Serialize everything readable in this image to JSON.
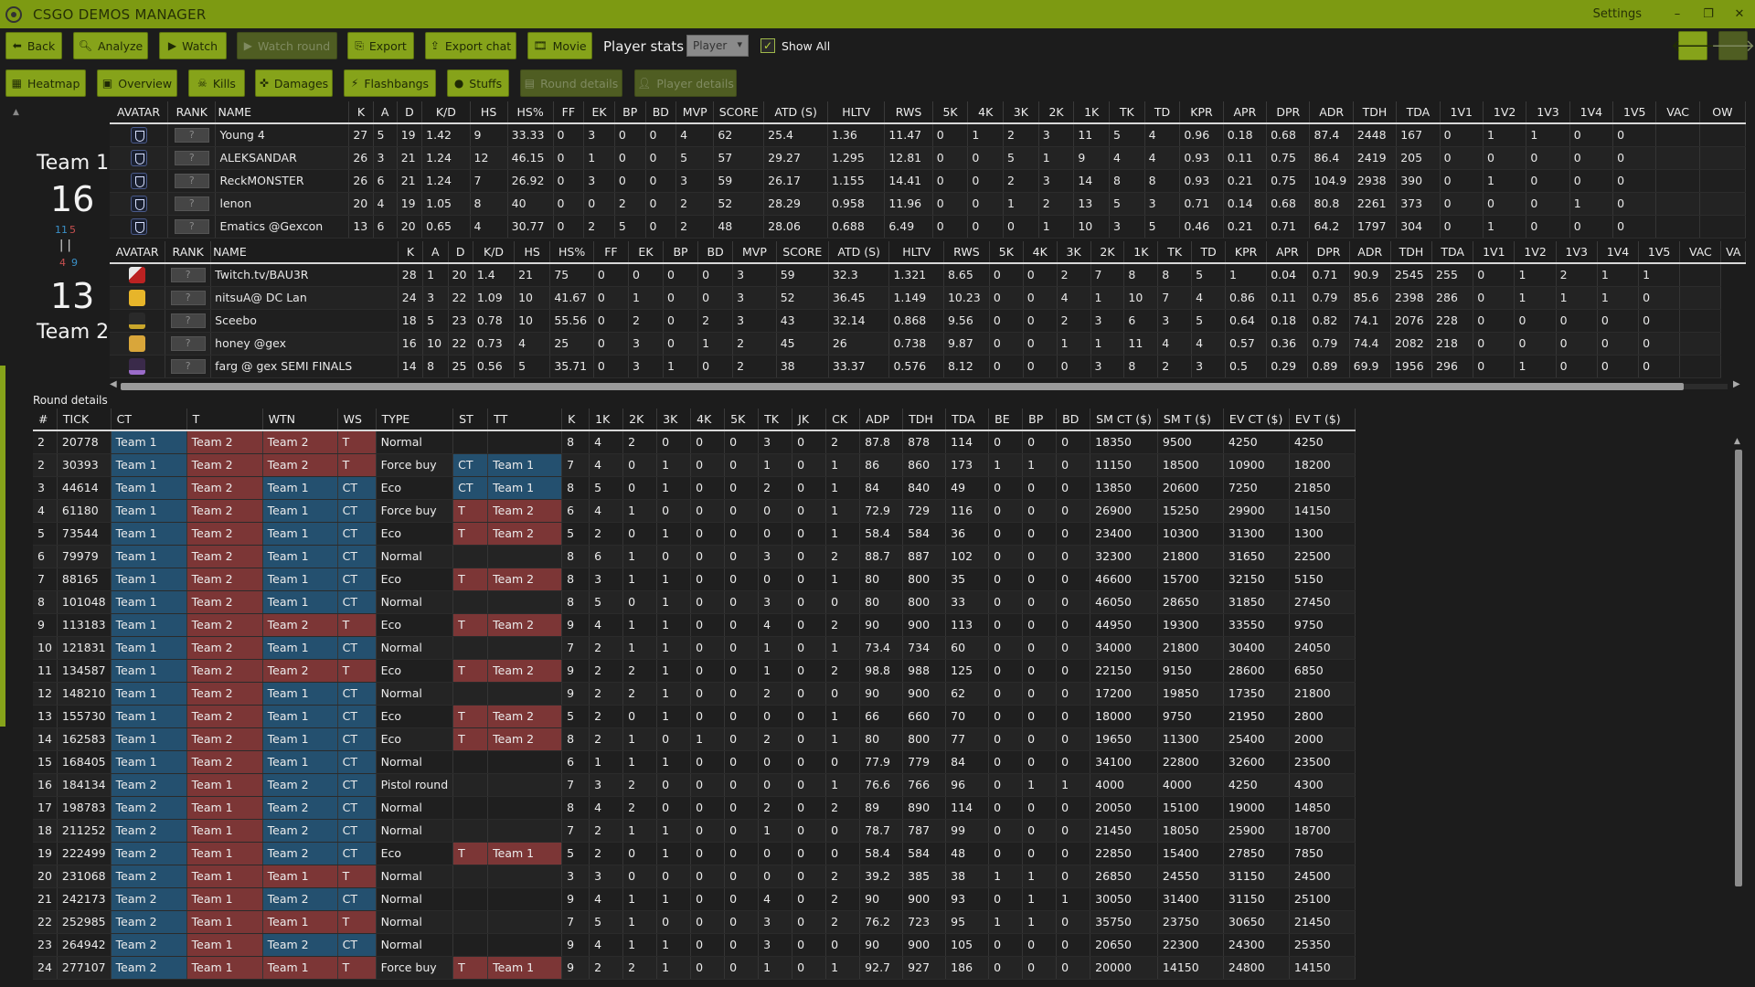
{
  "window": {
    "title": "CSGO DEMOS MANAGER",
    "settings": "Settings",
    "minimize": "–",
    "restore": "❐",
    "close": "✕"
  },
  "toolbar": {
    "back": "Back",
    "analyze": "Analyze",
    "watch": "Watch",
    "watch_round": "Watch round",
    "export": "Export",
    "export_chat": "Export chat",
    "movie": "Movie",
    "player_stats": "Player stats",
    "player_select": "Player",
    "show_all": "Show All"
  },
  "tabs": {
    "heatmap": "Heatmap",
    "overview": "Overview",
    "kills": "Kills",
    "damages": "Damages",
    "flashbangs": "Flashbangs",
    "stuffs": "Stuffs",
    "round_details": "Round details",
    "player_details": "Player details"
  },
  "teams": {
    "team1": {
      "name": "Team 1",
      "score": "16",
      "ct": "11",
      "t": "5"
    },
    "team2": {
      "name": "Team 2",
      "score": "13",
      "ct": "4",
      "t": "9"
    },
    "sep": "|  |"
  },
  "player_columns": [
    "AVATAR",
    "RANK",
    "NAME",
    "K",
    "A",
    "D",
    "K/D",
    "HS",
    "HS%",
    "FF",
    "EK",
    "BP",
    "BD",
    "MVP",
    "SCORE",
    "ATD (S)",
    "HLTV",
    "RWS",
    "5K",
    "4K",
    "3K",
    "2K",
    "1K",
    "TK",
    "TD",
    "KPR",
    "APR",
    "DPR",
    "ADR",
    "TDH",
    "TDA",
    "1V1",
    "1V2",
    "1V3",
    "1V4",
    "1V5",
    "VAC",
    "OW"
  ],
  "rank_placeholder": "?",
  "team1_players": [
    {
      "avatar": "shield",
      "cells": [
        "Young 4",
        "27",
        "5",
        "19",
        "1.42",
        "9",
        "33.33",
        "0",
        "3",
        "0",
        "0",
        "4",
        "62",
        "25.4",
        "1.36",
        "11.47",
        "0",
        "1",
        "2",
        "3",
        "11",
        "5",
        "4",
        "0.96",
        "0.18",
        "0.68",
        "87.4",
        "2448",
        "167",
        "0",
        "1",
        "1",
        "0",
        "0",
        "",
        ""
      ]
    },
    {
      "avatar": "shield",
      "cells": [
        "ALEKSANDAR",
        "26",
        "3",
        "21",
        "1.24",
        "12",
        "46.15",
        "0",
        "1",
        "0",
        "0",
        "5",
        "57",
        "29.27",
        "1.295",
        "12.81",
        "0",
        "0",
        "5",
        "1",
        "9",
        "4",
        "4",
        "0.93",
        "0.11",
        "0.75",
        "86.4",
        "2419",
        "205",
        "0",
        "0",
        "0",
        "0",
        "0",
        "",
        ""
      ]
    },
    {
      "avatar": "shield",
      "cells": [
        "ReckMONSTER",
        "26",
        "6",
        "21",
        "1.24",
        "7",
        "26.92",
        "0",
        "3",
        "0",
        "0",
        "3",
        "59",
        "26.17",
        "1.155",
        "14.41",
        "0",
        "0",
        "2",
        "3",
        "14",
        "8",
        "8",
        "0.93",
        "0.21",
        "0.75",
        "104.9",
        "2938",
        "390",
        "0",
        "1",
        "0",
        "0",
        "0",
        "",
        ""
      ]
    },
    {
      "avatar": "shield",
      "cells": [
        "lenon",
        "20",
        "4",
        "19",
        "1.05",
        "8",
        "40",
        "0",
        "0",
        "2",
        "0",
        "2",
        "52",
        "28.29",
        "0.958",
        "11.96",
        "0",
        "0",
        "1",
        "2",
        "13",
        "5",
        "3",
        "0.71",
        "0.14",
        "0.68",
        "80.8",
        "2261",
        "373",
        "0",
        "0",
        "0",
        "1",
        "0",
        "",
        ""
      ]
    },
    {
      "avatar": "shield",
      "cells": [
        "Ematics @Gexcon",
        "13",
        "6",
        "20",
        "0.65",
        "4",
        "30.77",
        "0",
        "2",
        "5",
        "0",
        "2",
        "48",
        "28.06",
        "0.688",
        "6.49",
        "0",
        "0",
        "0",
        "1",
        "10",
        "3",
        "5",
        "0.46",
        "0.21",
        "0.71",
        "64.2",
        "1797",
        "304",
        "0",
        "1",
        "0",
        "0",
        "0",
        "",
        ""
      ]
    }
  ],
  "team2_players": [
    {
      "avatar": "a",
      "cells": [
        "Twitch.tv/BAU3R",
        "28",
        "1",
        "20",
        "1.4",
        "21",
        "75",
        "0",
        "0",
        "0",
        "0",
        "3",
        "59",
        "32.3",
        "1.321",
        "8.65",
        "0",
        "0",
        "2",
        "7",
        "8",
        "8",
        "5",
        "1",
        "0.04",
        "0.71",
        "90.9",
        "2545",
        "255",
        "0",
        "1",
        "2",
        "1",
        "1",
        ""
      ]
    },
    {
      "avatar": "b",
      "cells": [
        "nitsuA@ DC Lan",
        "24",
        "3",
        "22",
        "1.09",
        "10",
        "41.67",
        "0",
        "1",
        "0",
        "0",
        "3",
        "52",
        "36.45",
        "1.149",
        "10.23",
        "0",
        "0",
        "4",
        "1",
        "10",
        "7",
        "4",
        "0.86",
        "0.11",
        "0.79",
        "85.6",
        "2398",
        "286",
        "0",
        "1",
        "1",
        "1",
        "0",
        ""
      ]
    },
    {
      "avatar": "c",
      "cells": [
        "Sceebo",
        "18",
        "5",
        "23",
        "0.78",
        "10",
        "55.56",
        "0",
        "2",
        "0",
        "2",
        "3",
        "43",
        "32.14",
        "0.868",
        "9.56",
        "0",
        "0",
        "2",
        "3",
        "6",
        "3",
        "5",
        "0.64",
        "0.18",
        "0.82",
        "74.1",
        "2076",
        "228",
        "0",
        "0",
        "0",
        "0",
        "0",
        ""
      ]
    },
    {
      "avatar": "d",
      "cells": [
        "honey @gex",
        "16",
        "10",
        "22",
        "0.73",
        "4",
        "25",
        "0",
        "3",
        "0",
        "1",
        "2",
        "45",
        "26",
        "0.738",
        "9.87",
        "0",
        "0",
        "1",
        "1",
        "11",
        "4",
        "4",
        "0.57",
        "0.36",
        "0.79",
        "74.4",
        "2082",
        "218",
        "0",
        "0",
        "0",
        "0",
        "0",
        ""
      ]
    },
    {
      "avatar": "e",
      "cells": [
        "farg @ gex SEMI FINALS",
        "14",
        "8",
        "25",
        "0.56",
        "5",
        "35.71",
        "0",
        "3",
        "1",
        "0",
        "2",
        "38",
        "33.37",
        "0.576",
        "8.12",
        "0",
        "0",
        "0",
        "3",
        "8",
        "2",
        "3",
        "0.5",
        "0.29",
        "0.89",
        "69.9",
        "1956",
        "296",
        "0",
        "1",
        "0",
        "0",
        "0",
        ""
      ]
    }
  ],
  "team2_columns_extra": "VA",
  "round_details": {
    "label": "Round details",
    "columns": [
      "#",
      "TICK",
      "CT",
      "T",
      "WTN",
      "WS",
      "TYPE",
      "ST",
      "TT",
      "K",
      "1K",
      "2K",
      "3K",
      "4K",
      "5K",
      "TK",
      "JK",
      "CK",
      "ADP",
      "TDH",
      "TDA",
      "BE",
      "BP",
      "BD",
      "SM CT ($)",
      "SM T ($)",
      "EV CT ($)",
      "EV T ($)"
    ],
    "rows": [
      [
        "2",
        "20778",
        "Team 1",
        "Team 2",
        "Team 2",
        "T",
        "Normal",
        "",
        "",
        "8",
        "4",
        "2",
        "0",
        "0",
        "0",
        "3",
        "0",
        "2",
        "87.8",
        "878",
        "114",
        "0",
        "0",
        "0",
        "18350",
        "9500",
        "4250",
        "4250"
      ],
      [
        "2",
        "30393",
        "Team 1",
        "Team 2",
        "Team 2",
        "T",
        "Force buy",
        "CT",
        "Team 1",
        "7",
        "4",
        "0",
        "1",
        "0",
        "0",
        "1",
        "0",
        "1",
        "86",
        "860",
        "173",
        "1",
        "1",
        "0",
        "11150",
        "18500",
        "10900",
        "18200"
      ],
      [
        "3",
        "44614",
        "Team 1",
        "Team 2",
        "Team 1",
        "CT",
        "Eco",
        "CT",
        "Team 1",
        "8",
        "5",
        "0",
        "1",
        "0",
        "0",
        "2",
        "0",
        "1",
        "84",
        "840",
        "49",
        "0",
        "0",
        "0",
        "13850",
        "20600",
        "7250",
        "21850"
      ],
      [
        "4",
        "61180",
        "Team 1",
        "Team 2",
        "Team 1",
        "CT",
        "Force buy",
        "T",
        "Team 2",
        "6",
        "4",
        "1",
        "0",
        "0",
        "0",
        "0",
        "0",
        "1",
        "72.9",
        "729",
        "116",
        "0",
        "0",
        "0",
        "26900",
        "15250",
        "29900",
        "14150"
      ],
      [
        "5",
        "73544",
        "Team 1",
        "Team 2",
        "Team 1",
        "CT",
        "Eco",
        "T",
        "Team 2",
        "5",
        "2",
        "0",
        "1",
        "0",
        "0",
        "0",
        "0",
        "1",
        "58.4",
        "584",
        "36",
        "0",
        "0",
        "0",
        "23400",
        "10300",
        "31300",
        "1300"
      ],
      [
        "6",
        "79979",
        "Team 1",
        "Team 2",
        "Team 1",
        "CT",
        "Normal",
        "",
        "",
        "8",
        "6",
        "1",
        "0",
        "0",
        "0",
        "3",
        "0",
        "2",
        "88.7",
        "887",
        "102",
        "0",
        "0",
        "0",
        "32300",
        "21800",
        "31650",
        "22500"
      ],
      [
        "7",
        "88165",
        "Team 1",
        "Team 2",
        "Team 1",
        "CT",
        "Eco",
        "T",
        "Team 2",
        "8",
        "3",
        "1",
        "1",
        "0",
        "0",
        "0",
        "0",
        "1",
        "80",
        "800",
        "35",
        "0",
        "0",
        "0",
        "46600",
        "15700",
        "32150",
        "5150"
      ],
      [
        "8",
        "101048",
        "Team 1",
        "Team 2",
        "Team 1",
        "CT",
        "Normal",
        "",
        "",
        "8",
        "5",
        "0",
        "1",
        "0",
        "0",
        "3",
        "0",
        "0",
        "80",
        "800",
        "33",
        "0",
        "0",
        "0",
        "46050",
        "28650",
        "31850",
        "27450"
      ],
      [
        "9",
        "113183",
        "Team 1",
        "Team 2",
        "Team 2",
        "T",
        "Eco",
        "T",
        "Team 2",
        "9",
        "4",
        "1",
        "1",
        "0",
        "0",
        "4",
        "0",
        "2",
        "90",
        "900",
        "113",
        "0",
        "0",
        "0",
        "44950",
        "19300",
        "33550",
        "9750"
      ],
      [
        "10",
        "121831",
        "Team 1",
        "Team 2",
        "Team 1",
        "CT",
        "Normal",
        "",
        "",
        "7",
        "2",
        "1",
        "1",
        "0",
        "0",
        "1",
        "0",
        "1",
        "73.4",
        "734",
        "60",
        "0",
        "0",
        "0",
        "34000",
        "21800",
        "30400",
        "24050"
      ],
      [
        "11",
        "134587",
        "Team 1",
        "Team 2",
        "Team 2",
        "T",
        "Eco",
        "T",
        "Team 2",
        "9",
        "2",
        "2",
        "1",
        "0",
        "0",
        "1",
        "0",
        "2",
        "98.8",
        "988",
        "125",
        "0",
        "0",
        "0",
        "22150",
        "9150",
        "28600",
        "6850"
      ],
      [
        "12",
        "148210",
        "Team 1",
        "Team 2",
        "Team 1",
        "CT",
        "Normal",
        "",
        "",
        "9",
        "2",
        "2",
        "1",
        "0",
        "0",
        "2",
        "0",
        "0",
        "90",
        "900",
        "62",
        "0",
        "0",
        "0",
        "17200",
        "19850",
        "17350",
        "21800"
      ],
      [
        "13",
        "155730",
        "Team 1",
        "Team 2",
        "Team 1",
        "CT",
        "Eco",
        "T",
        "Team 2",
        "5",
        "2",
        "0",
        "1",
        "0",
        "0",
        "0",
        "0",
        "1",
        "66",
        "660",
        "70",
        "0",
        "0",
        "0",
        "18000",
        "9750",
        "21950",
        "2800"
      ],
      [
        "14",
        "162583",
        "Team 1",
        "Team 2",
        "Team 1",
        "CT",
        "Eco",
        "T",
        "Team 2",
        "8",
        "2",
        "1",
        "0",
        "1",
        "0",
        "2",
        "0",
        "1",
        "80",
        "800",
        "77",
        "0",
        "0",
        "0",
        "19650",
        "11300",
        "25400",
        "2000"
      ],
      [
        "15",
        "168405",
        "Team 1",
        "Team 2",
        "Team 1",
        "CT",
        "Normal",
        "",
        "",
        "6",
        "1",
        "1",
        "1",
        "0",
        "0",
        "0",
        "0",
        "0",
        "77.9",
        "779",
        "84",
        "0",
        "0",
        "0",
        "34100",
        "22800",
        "32600",
        "23500"
      ],
      [
        "16",
        "184134",
        "Team 2",
        "Team 1",
        "Team 2",
        "CT",
        "Pistol round",
        "",
        "",
        "7",
        "3",
        "2",
        "0",
        "0",
        "0",
        "0",
        "0",
        "1",
        "76.6",
        "766",
        "96",
        "0",
        "1",
        "1",
        "4000",
        "4000",
        "4250",
        "4300"
      ],
      [
        "17",
        "198783",
        "Team 2",
        "Team 1",
        "Team 2",
        "CT",
        "Normal",
        "",
        "",
        "8",
        "4",
        "2",
        "0",
        "0",
        "0",
        "2",
        "0",
        "2",
        "89",
        "890",
        "114",
        "0",
        "0",
        "0",
        "20050",
        "15100",
        "19000",
        "14850"
      ],
      [
        "18",
        "211252",
        "Team 2",
        "Team 1",
        "Team 2",
        "CT",
        "Normal",
        "",
        "",
        "7",
        "2",
        "1",
        "1",
        "0",
        "0",
        "1",
        "0",
        "0",
        "78.7",
        "787",
        "99",
        "0",
        "0",
        "0",
        "21450",
        "18050",
        "25900",
        "18700"
      ],
      [
        "19",
        "222499",
        "Team 2",
        "Team 1",
        "Team 2",
        "CT",
        "Eco",
        "T",
        "Team 1",
        "5",
        "2",
        "0",
        "1",
        "0",
        "0",
        "0",
        "0",
        "0",
        "58.4",
        "584",
        "48",
        "0",
        "0",
        "0",
        "22850",
        "15400",
        "27850",
        "7850"
      ],
      [
        "20",
        "231068",
        "Team 2",
        "Team 1",
        "Team 1",
        "T",
        "Normal",
        "",
        "",
        "3",
        "3",
        "0",
        "0",
        "0",
        "0",
        "0",
        "0",
        "2",
        "39.2",
        "385",
        "38",
        "1",
        "1",
        "0",
        "26850",
        "24550",
        "31150",
        "24500"
      ],
      [
        "21",
        "242173",
        "Team 2",
        "Team 1",
        "Team 2",
        "CT",
        "Normal",
        "",
        "",
        "9",
        "4",
        "1",
        "1",
        "0",
        "0",
        "4",
        "0",
        "2",
        "90",
        "900",
        "93",
        "0",
        "1",
        "1",
        "30050",
        "31400",
        "31150",
        "25100"
      ],
      [
        "22",
        "252985",
        "Team 2",
        "Team 1",
        "Team 1",
        "T",
        "Normal",
        "",
        "",
        "7",
        "5",
        "1",
        "0",
        "0",
        "0",
        "3",
        "0",
        "2",
        "76.2",
        "723",
        "95",
        "1",
        "1",
        "0",
        "35750",
        "23750",
        "30650",
        "21450"
      ],
      [
        "23",
        "264942",
        "Team 2",
        "Team 1",
        "Team 2",
        "CT",
        "Normal",
        "",
        "",
        "9",
        "4",
        "1",
        "1",
        "0",
        "0",
        "3",
        "0",
        "0",
        "90",
        "900",
        "105",
        "0",
        "0",
        "0",
        "20650",
        "22300",
        "24300",
        "25350"
      ],
      [
        "24",
        "277107",
        "Team 2",
        "Team 1",
        "Team 1",
        "T",
        "Force buy",
        "T",
        "Team 1",
        "9",
        "2",
        "2",
        "1",
        "0",
        "0",
        "1",
        "0",
        "1",
        "92.7",
        "927",
        "186",
        "0",
        "0",
        "0",
        "20000",
        "14150",
        "24800",
        "14150"
      ]
    ]
  },
  "colors": {
    "accent": "#86a31a",
    "ct": "#24506f",
    "t": "#7c3636"
  }
}
